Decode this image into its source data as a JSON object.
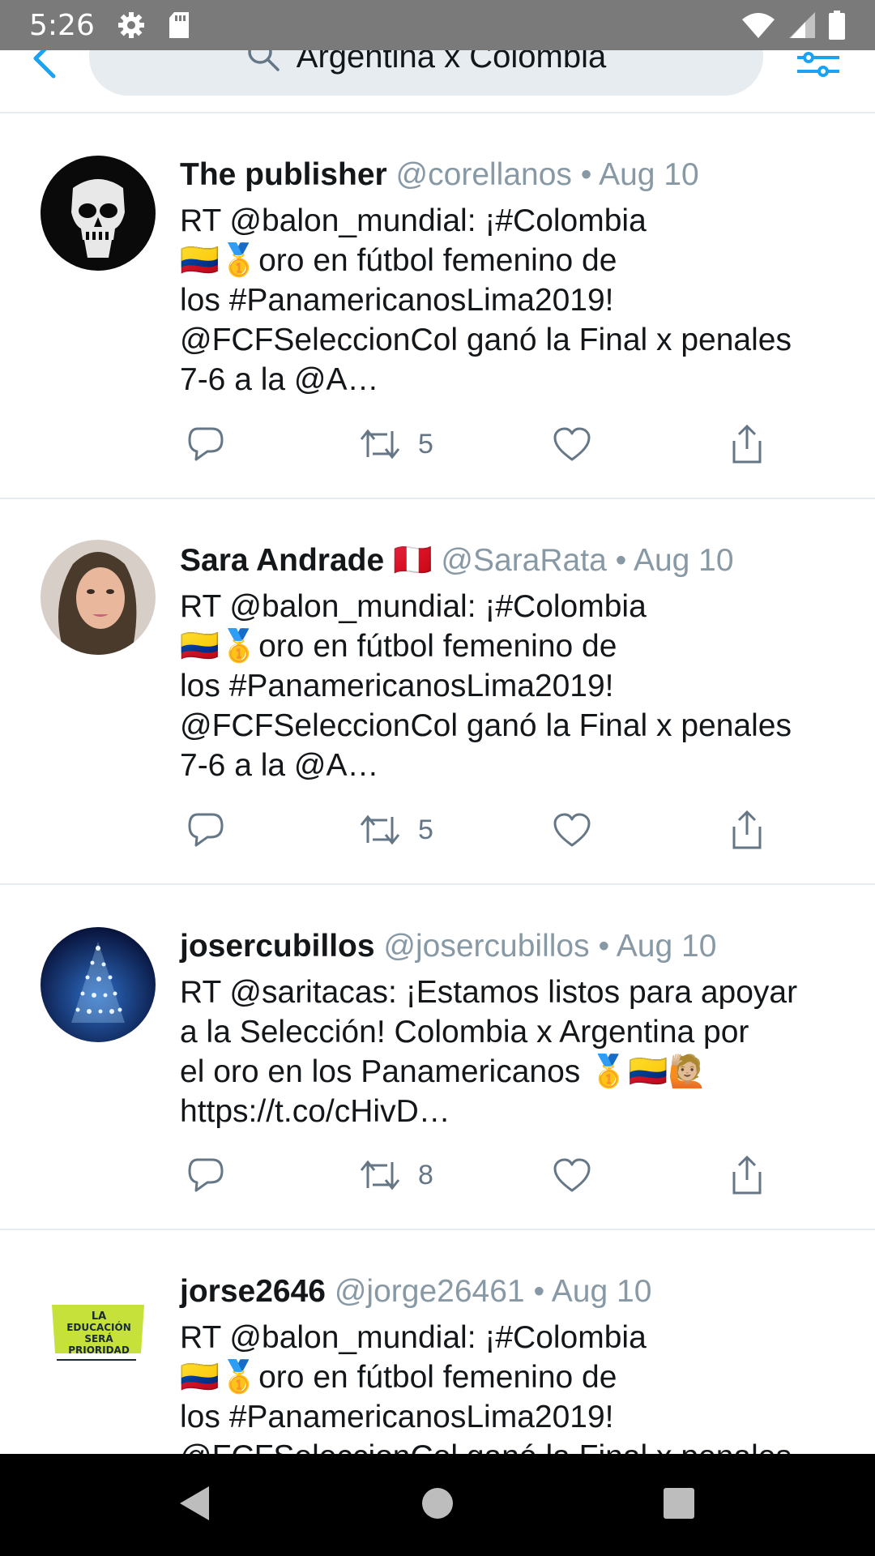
{
  "status_bar": {
    "time": "5:26",
    "icons": [
      "gear-icon",
      "sd-card-icon",
      "wifi-icon",
      "signal-icon",
      "battery-icon"
    ]
  },
  "search": {
    "query": "Argentina x Colômbia",
    "back_icon": "back-arrow-icon",
    "filter_icon": "filter-icon"
  },
  "colors": {
    "accent": "#1da1f2",
    "secondary_text": "#8899a6",
    "divider": "#e6ecf0"
  },
  "tweets": [
    {
      "name": "The publisher",
      "name_badge": "",
      "handle": "@corellanos",
      "dot": "•",
      "date": "Aug 10",
      "body": "RT @balon_mundial: ¡#Colombia\n🇨🇴🥇oro en fútbol femenino de\nlos #PanamericanosLima2019!\n@FCFSeleccionCol ganó la Final x penales\n7-6 a la @A…",
      "retweets": "5"
    },
    {
      "name": "Sara Andrade",
      "name_badge": "🇵🇪",
      "handle": "@SaraRata",
      "dot": "•",
      "date": "Aug 10",
      "body": "RT @balon_mundial: ¡#Colombia\n🇨🇴🥇oro en fútbol femenino de\nlos #PanamericanosLima2019!\n@FCFSeleccionCol ganó la Final x penales\n7-6 a la @A…",
      "retweets": "5"
    },
    {
      "name": "josercubillos",
      "name_badge": "",
      "handle": "@josercubillos",
      "dot": "•",
      "date": "Aug 10",
      "body": "RT @saritacas: ¡Estamos listos para apoyar\na la Selección! Colombia x Argentina por\nel oro en los Panamericanos 🥇🇨🇴🙋🏼\nhttps://t.co/cHivD…",
      "retweets": "8"
    },
    {
      "name": "jorse2646",
      "name_badge": "",
      "handle": "@jorge26461",
      "dot": "•",
      "date": "Aug 10",
      "body": "RT @balon_mundial: ¡#Colombia\n🇨🇴🥇oro en fútbol femenino de\nlos #PanamericanosLima2019!\n@FCFSeleccionCol ganó la Final x penales",
      "retweets": ""
    }
  ],
  "avatar_4_text": "LA EDUCACIÓN SERÁ PRIORIDAD",
  "nav": {
    "back": "nav-back-icon",
    "home": "nav-home-icon",
    "recents": "nav-recents-icon"
  }
}
